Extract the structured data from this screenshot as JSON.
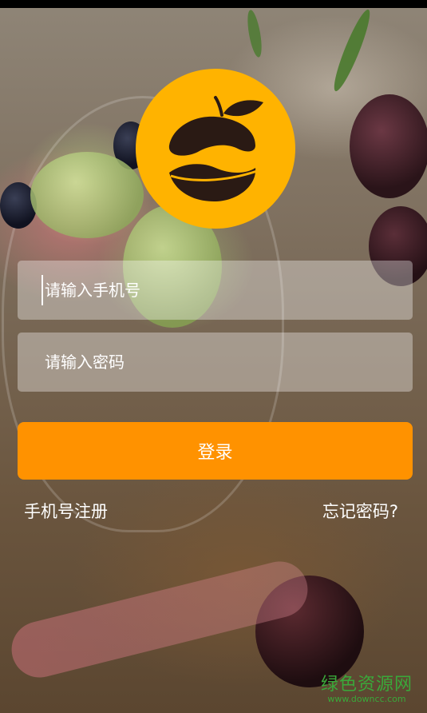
{
  "login": {
    "phone_placeholder": "请输入手机号",
    "password_placeholder": "请输入密码",
    "submit_label": "登录",
    "register_label": "手机号注册",
    "forgot_label": "忘记密码?"
  },
  "watermark": {
    "main": "绿色资源网",
    "sub": "www.downcc.com"
  },
  "colors": {
    "brand_yellow": "#ffb300",
    "button_orange": "#ff9200",
    "logo_fruit": "#2a1a14"
  }
}
